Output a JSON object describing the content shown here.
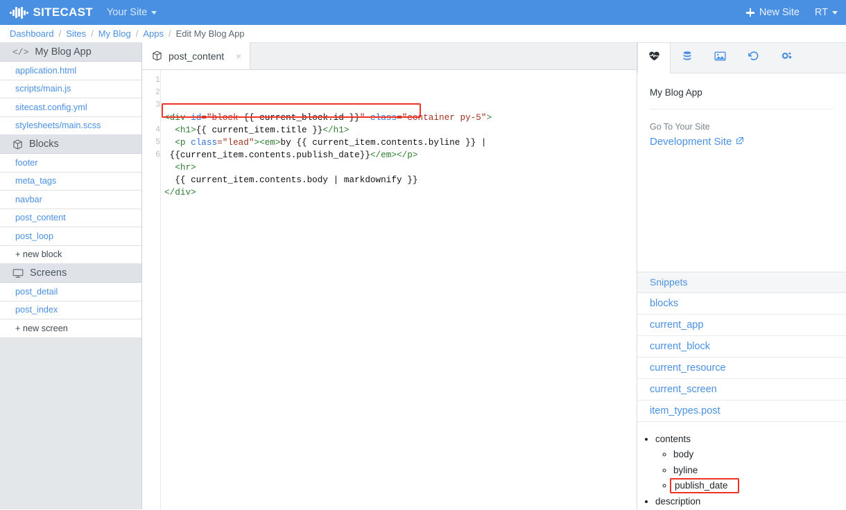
{
  "topbar": {
    "brand": "SITECAST",
    "logo_icon": "audio-wave-icon",
    "site_switcher": "Your Site",
    "new_site": "New Site",
    "user_initials": "RT"
  },
  "breadcrumb": {
    "items": [
      {
        "label": "Dashboard",
        "link": true
      },
      {
        "label": "Sites",
        "link": true
      },
      {
        "label": "My Blog",
        "link": true
      },
      {
        "label": "Apps",
        "link": true
      },
      {
        "label": "Edit My Blog App",
        "link": false
      }
    ],
    "separator": "/"
  },
  "sidebar": {
    "app_header": {
      "icon": "code-brackets-icon",
      "label": "My Blog App"
    },
    "files": [
      {
        "label": "application.html"
      },
      {
        "label": "scripts/main.js"
      },
      {
        "label": "sitecast.config.yml"
      },
      {
        "label": "stylesheets/main.scss"
      }
    ],
    "blocks_header": {
      "icon": "cube-icon",
      "label": "Blocks"
    },
    "blocks": [
      {
        "label": "footer"
      },
      {
        "label": "meta_tags"
      },
      {
        "label": "navbar"
      },
      {
        "label": "post_content"
      },
      {
        "label": "post_loop"
      }
    ],
    "new_block": "+ new block",
    "screens_header": {
      "icon": "monitor-icon",
      "label": "Screens"
    },
    "screens": [
      {
        "label": "post_detail"
      },
      {
        "label": "post_index"
      }
    ],
    "new_screen": "+ new screen"
  },
  "editor": {
    "tab": {
      "icon": "cube-icon",
      "label": "post_content",
      "close": "×"
    },
    "gutter": [
      "1",
      "2",
      "3",
      "",
      "4",
      "5",
      "6"
    ],
    "code_lines": [
      [
        {
          "t": "<div ",
          "c": "tg"
        },
        {
          "t": "id",
          "c": "at"
        },
        {
          "t": "=\"block-",
          "c": "st"
        },
        {
          "t": "{{ current_block.id }}",
          "c": "pl"
        },
        {
          "t": "\"",
          "c": "st"
        },
        {
          "t": " ",
          "c": "pl"
        },
        {
          "t": "class",
          "c": "at"
        },
        {
          "t": "=\"container py-5\"",
          "c": "st"
        },
        {
          "t": ">",
          "c": "tg"
        }
      ],
      [
        {
          "t": "  <h1>",
          "c": "tg"
        },
        {
          "t": "{{ current_item.title }}",
          "c": "pl"
        },
        {
          "t": "</h1>",
          "c": "tg"
        }
      ],
      [
        {
          "t": "  <p ",
          "c": "tg"
        },
        {
          "t": "class",
          "c": "at"
        },
        {
          "t": "=\"lead\"",
          "c": "st"
        },
        {
          "t": "><em>",
          "c": "tg"
        },
        {
          "t": "by {{ current_item.contents.byline }} |",
          "c": "pl"
        }
      ],
      [
        {
          "t": " {{current_item.contents.publish_date}}",
          "c": "pl"
        },
        {
          "t": "</em></p>",
          "c": "tg"
        }
      ],
      [
        {
          "t": "  <hr>",
          "c": "tg"
        }
      ],
      [
        {
          "t": "  {{ current_item.contents.body | markdownify }}",
          "c": "pl"
        }
      ],
      [
        {
          "t": "</div>",
          "c": "tg"
        }
      ]
    ],
    "highlight_color": "#ee3224"
  },
  "rightpanel": {
    "tabs": [
      {
        "icon": "heartbeat-icon",
        "active": true
      },
      {
        "icon": "database-icon",
        "active": false
      },
      {
        "icon": "image-icon",
        "active": false
      },
      {
        "icon": "history-icon",
        "active": false
      },
      {
        "icon": "gears-icon",
        "active": false
      }
    ],
    "app_name": "My Blog App",
    "goto_label": "Go To Your Site",
    "site_link": "Development Site",
    "site_link_icon": "external-link-icon",
    "snippets_header": "Snippets",
    "snippets": [
      {
        "label": "blocks"
      },
      {
        "label": "current_app"
      },
      {
        "label": "current_block"
      },
      {
        "label": "current_resource"
      },
      {
        "label": "current_screen"
      },
      {
        "label": "item_types.post"
      }
    ],
    "tree": {
      "root": "contents",
      "children": [
        "body",
        "byline",
        "publish_date"
      ],
      "highlighted": "publish_date",
      "next_sibling": "description"
    }
  },
  "colors": {
    "brand_blue": "#4a90e2",
    "link_blue": "#4a90e2",
    "highlight_red": "#ee3224",
    "sidebar_bg": "#e3e7ea"
  }
}
